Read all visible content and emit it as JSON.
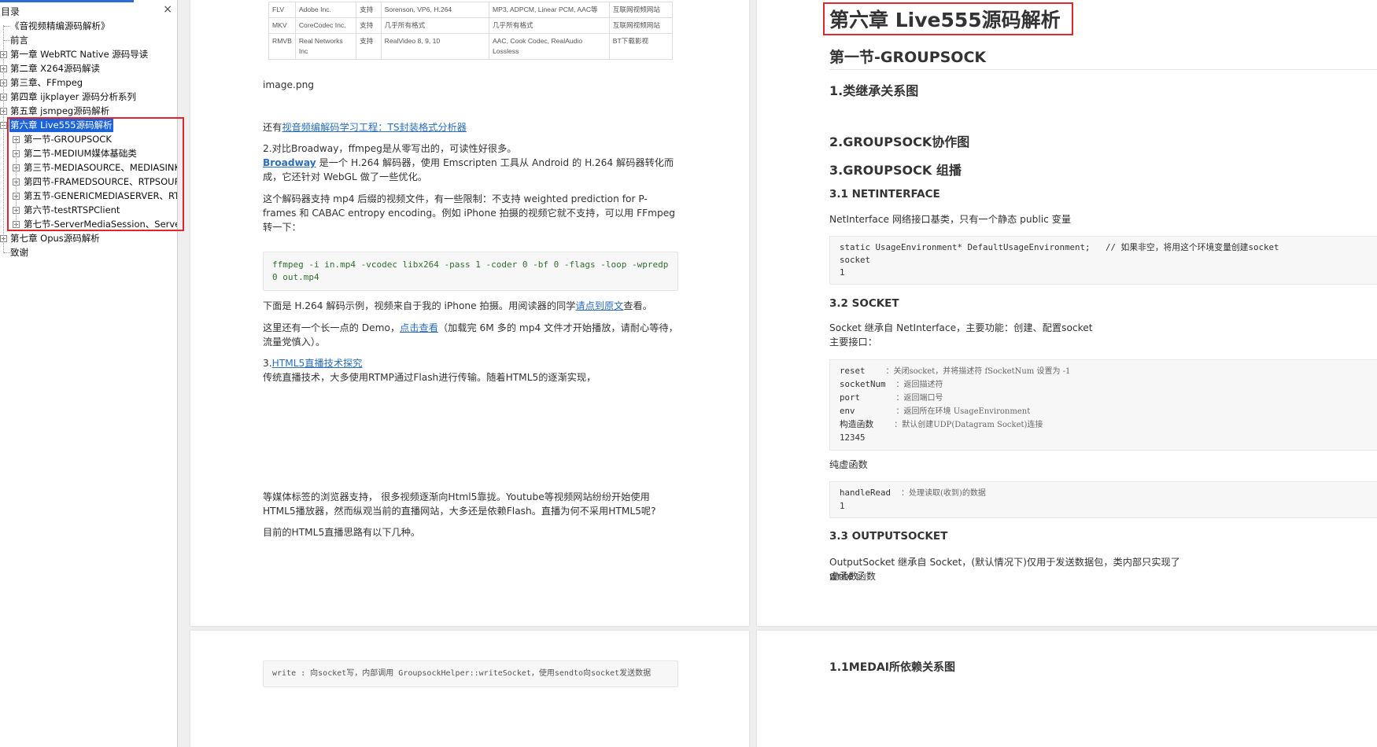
{
  "sidebar": {
    "title": "目录",
    "close": "×",
    "items": [
      {
        "label": "《音视频精编源码解析》",
        "level": 0,
        "expander": ""
      },
      {
        "label": "前言",
        "level": 0,
        "expander": ""
      },
      {
        "label": "第一章 WebRTC Native 源码导读",
        "level": 0,
        "expander": "+"
      },
      {
        "label": "第二章 X264源码解读",
        "level": 0,
        "expander": "+"
      },
      {
        "label": "第三章、FFmpeg",
        "level": 0,
        "expander": "+"
      },
      {
        "label": "第四章 ijkplayer 源码分析系列",
        "level": 0,
        "expander": "+"
      },
      {
        "label": "第五章 jsmpeg源码解析",
        "level": 0,
        "expander": "+"
      },
      {
        "label": "第六章 Live555源码解析",
        "level": 0,
        "expander": "−",
        "selected": true
      },
      {
        "label": "第一节-GROUPSOCK",
        "level": 1,
        "expander": "+"
      },
      {
        "label": "第二节-MEDIUM媒体基础类",
        "level": 1,
        "expander": "+"
      },
      {
        "label": "第三节-MEDIASOURCE、MEDIASINK、",
        "level": 1,
        "expander": "+"
      },
      {
        "label": "第四节-FRAMEDSOURCE、RTPSOURC",
        "level": 1,
        "expander": "+"
      },
      {
        "label": "第五节-GENERICMEDIASERVER、RTSF",
        "level": 1,
        "expander": "+"
      },
      {
        "label": "第六节-testRTSPClient",
        "level": 1,
        "expander": "+"
      },
      {
        "label": "第七节-ServerMediaSession、ServerM",
        "level": 1,
        "expander": "+"
      },
      {
        "label": "第七章 Opus源码解析",
        "level": 0,
        "expander": "+"
      },
      {
        "label": "致谢",
        "level": 0,
        "expander": ""
      }
    ]
  },
  "left_page": {
    "table_rows": [
      [
        "FLV",
        "Adobe Inc.",
        "支持",
        "Sorenson, VP6, H.264",
        "MP3, ADPCM, Linear PCM, AAC等",
        "互联网视频网站"
      ],
      [
        "MKV",
        "CoreCodec Inc.",
        "支持",
        "几乎所有格式",
        "几乎所有格式",
        "互联网视频网站"
      ],
      [
        "RMVB",
        "Real Networks Inc",
        "支持",
        "RealVideo 8, 9, 10",
        "AAC, Cook Codec, RealAudio Lossless",
        "BT下载影视"
      ]
    ],
    "image_caption": "image.png",
    "p1_prefix": "还有",
    "p1_link": "视音频编解码学习工程：TS封装格式分析器",
    "p2_line1": "2.对比Broadway，ffmpeg是从零写出的，可读性好很多。",
    "p2_link": "Broadway",
    "p2_rest": " 是一个 H.264 解码器，使用 Emscripten 工具从 Android 的 H.264 解码器转化而成，它还针对 WebGL 做了一些优化。",
    "p3": "这个解码器支持 mp4 后缀的视频文件，有一些限制：不支持 weighted prediction for P-frames 和 CABAC entropy encoding。例如 iPhone 拍摄的视频它就不支持，可以用 FFmpeg 转一下：",
    "code1": "ffmpeg -i in.mp4 -vcodec libx264 -pass 1 -coder 0 -bf 0 -flags -loop -wpredp 0 out.mp4",
    "p4_prefix": "下面是 H.264 解码示例，视频来自于我的 iPhone 拍摄。用阅读器的同学",
    "p4_link": "请点到原文",
    "p4_suffix": "查看。",
    "p5_prefix": "这里还有一个长一点的 Demo，",
    "p5_link": "点击查看",
    "p5_suffix": "（加载完 6M 多的 mp4 文件才开始播放，请耐心等待，流量党慎入）。",
    "p6_prefix": "3.",
    "p6_link": "HTML5直播技术探究",
    "p6_line2": " 传统直播技术，大多使用RTMP通过Flash进行传输。随着HTML5的逐渐实现，",
    "p7": "等媒体标签的浏览器支持， 很多视频逐渐向Html5靠拢。Youtube等视频网站纷纷开始使用HTML5播放器，然而纵观当前的直播网站，大多还是依赖Flash。直播为何不采用HTML5呢?",
    "p8": "目前的HTML5直播思路有以下几种。",
    "bottom_code_partial": "write   : 向socket写，内部调用 GroupsockHelper::writeSocket，使用sendto向socket发送数据"
  },
  "right_page": {
    "chapter_title": "第六章 Live555源码解析",
    "section_title": "第一节-GROUPSOCK",
    "h_1": "1.类继承关系图",
    "h_2": "2.GROUPSOCK协作图",
    "h_3": "3.GROUPSOCK 组播",
    "h_31": "3.1 NETINTERFACE",
    "t_31": "NetInterface 网络接口基类，只有一个静态 public 变量",
    "code_31_line1": "static UsageEnvironment* DefaultUsageEnvironment;   // 如果非空，将用这个环境变量创建socket",
    "code_31_line2": "1",
    "h_32": "3.2 SOCKET",
    "t_32a": "Socket 继承自 NetInterface，主要功能：创建、配置socket",
    "t_32b": "主要接口：",
    "code_32": [
      {
        "name": "reset    ",
        "desc": "：关闭socket，并将描述符 fSocketNum 设置为 -1"
      },
      {
        "name": "socketNum  ",
        "desc": "：返回描述符"
      },
      {
        "name": "port       ",
        "desc": "：返回端口号"
      },
      {
        "name": "env        ",
        "desc": "：返回所在环境 UsageEnvironment"
      },
      {
        "name": "构造函数    ",
        "desc": "：默认创建UDP(Datagram Socket)连接"
      },
      {
        "name": "12345",
        "desc": ""
      }
    ],
    "t_pure": "纯虚函数",
    "code_pure_line1_name": "handleRead  ",
    "code_pure_line1_desc": "：处理读取(收到)的数据",
    "code_pure_line2": "1",
    "h_33": "3.3 OUTPUTSOCKET",
    "t_33a": "OutputSocket 继承自 Socket，(默认情况下)仅用于发送数据包，类内部只实现了 write 函数",
    "t_33b": "虚函数:",
    "bottom_heading_partial": "1.1MEDAI所依赖关系图"
  }
}
